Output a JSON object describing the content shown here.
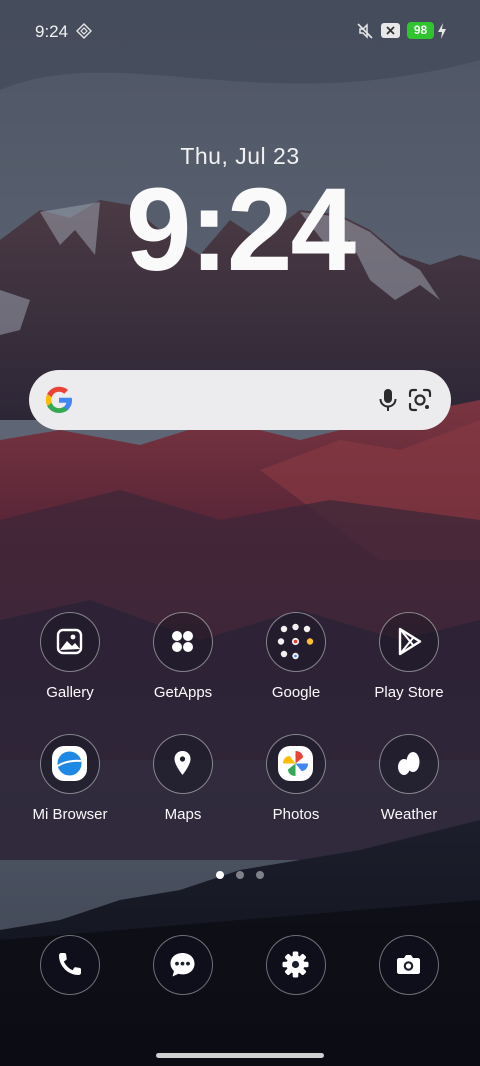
{
  "status_bar": {
    "time": "9:24",
    "battery": "98",
    "icons": [
      "sync-diamond-icon",
      "mute-icon",
      "no-sim-icon",
      "battery-icon",
      "charging-bolt-icon"
    ]
  },
  "clock_widget": {
    "date": "Thu, Jul 23",
    "time": "9:24"
  },
  "search_bar": {
    "icons": [
      "google-g-icon",
      "microphone-icon",
      "google-lens-icon"
    ]
  },
  "apps": [
    {
      "label": "Gallery",
      "icon": "gallery-icon"
    },
    {
      "label": "GetApps",
      "icon": "getapps-icon"
    },
    {
      "label": "Google",
      "icon": "google-folder-icon"
    },
    {
      "label": "Play Store",
      "icon": "play-store-icon"
    },
    {
      "label": "Mi Browser",
      "icon": "mi-browser-icon"
    },
    {
      "label": "Maps",
      "icon": "maps-icon"
    },
    {
      "label": "Photos",
      "icon": "photos-icon"
    },
    {
      "label": "Weather",
      "icon": "weather-icon"
    }
  ],
  "pager": {
    "count": 3,
    "active_index": 0
  },
  "dock": [
    {
      "icon": "phone-icon"
    },
    {
      "icon": "messages-icon"
    },
    {
      "icon": "settings-icon"
    },
    {
      "icon": "camera-icon"
    }
  ],
  "colors": {
    "battery": "#2fc52f",
    "search_bar": "#ececef"
  }
}
